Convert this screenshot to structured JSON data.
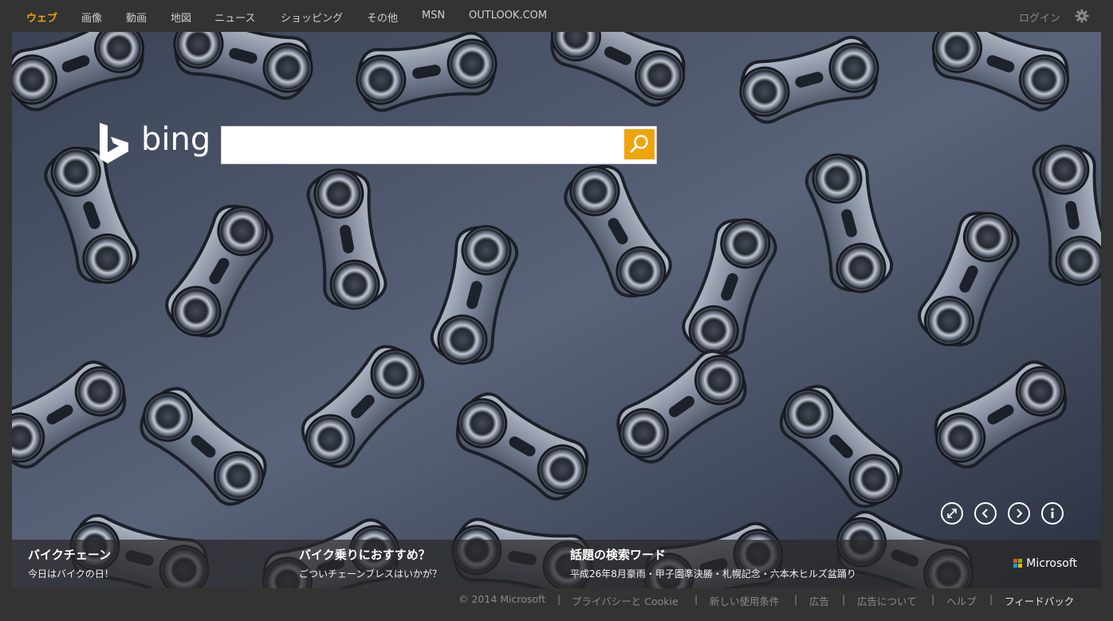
{
  "nav": {
    "items": [
      {
        "label": "ウェブ",
        "active": true
      },
      {
        "label": "画像",
        "active": false
      },
      {
        "label": "動画",
        "active": false
      },
      {
        "label": "地図",
        "active": false
      },
      {
        "label": "ニュース",
        "active": false
      },
      {
        "label": "ショッピング",
        "active": false
      },
      {
        "label": "その他",
        "active": false
      },
      {
        "label": "MSN",
        "active": false
      },
      {
        "label": "OUTLOOK.COM",
        "active": false
      }
    ],
    "login_label": "ログイン",
    "settings_icon": "gear-icon"
  },
  "logo": {
    "word": "bing"
  },
  "search": {
    "value": "",
    "placeholder": "",
    "button_icon": "search-icon"
  },
  "hero_controls": {
    "icons": [
      "expand-icon",
      "chevron-left-icon",
      "chevron-right-icon",
      "info-icon"
    ]
  },
  "captions": [
    {
      "title": "バイクチェーン",
      "subtitle": "今日はバイクの日！"
    },
    {
      "title": "バイク乗りにおすすめ？",
      "subtitle": "ごついチェーンブレスはいかが？"
    },
    {
      "title": "話題の検索ワード",
      "subtitle": "平成26年8月豪雨・甲子園準決勝・札幌記念・六本木ヒルズ盆踊り"
    }
  ],
  "brand": {
    "microsoft_label": "Microsoft"
  },
  "footer": {
    "copyright": "© 2014 Microsoft",
    "links": [
      "プライバシーと Cookie",
      "新しい使用条件",
      "広告",
      "広告について",
      "ヘルプ"
    ],
    "feedback": "フィードバック",
    "separator": "|"
  },
  "colors": {
    "accent": "#f0a30a",
    "background": "#333333",
    "caption_bar": "#282828"
  }
}
